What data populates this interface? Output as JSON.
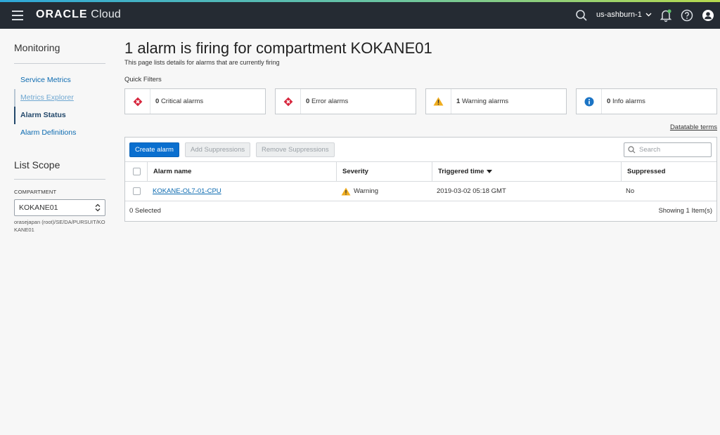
{
  "header": {
    "brand_bold": "ORACLE",
    "brand_rest": " Cloud",
    "region": "us-ashburn-1"
  },
  "icons": {
    "menu": "hamburger-menu-icon",
    "search": "search-icon",
    "notifications": "bell-icon",
    "help": "help-icon",
    "user": "user-icon"
  },
  "sidebar": {
    "title": "Monitoring",
    "items": [
      {
        "label": "Service Metrics",
        "state": "link"
      },
      {
        "label": "Metrics Explorer",
        "state": "visited"
      },
      {
        "label": "Alarm Status",
        "state": "active"
      },
      {
        "label": "Alarm Definitions",
        "state": "link"
      }
    ],
    "scope_title": "List Scope",
    "compartment_label": "COMPARTMENT",
    "compartment_value": "KOKANE01",
    "compartment_path": "orasejapan (root)/SE/DA/PURSUIT/KOKANE01"
  },
  "main": {
    "title": "1 alarm is firing for compartment KOKANE01",
    "subtitle": "This page lists details for alarms that are currently firing",
    "quick_filters_label": "Quick Filters",
    "quick_filters": [
      {
        "count": "0",
        "label": "Critical alarms",
        "icon": "critical-icon",
        "color": "#d7263d"
      },
      {
        "count": "0",
        "label": "Error alarms",
        "icon": "error-icon",
        "color": "#d7263d"
      },
      {
        "count": "1",
        "label": "Warning alarms",
        "icon": "warning-icon",
        "color": "#f0ad1e"
      },
      {
        "count": "0",
        "label": "Info alarms",
        "icon": "info-icon",
        "color": "#1b74c5"
      }
    ],
    "datatable_terms": "Datatable terms",
    "toolbar": {
      "create_label": "Create alarm",
      "add_suppressions_label": "Add Suppressions",
      "remove_suppressions_label": "Remove Suppressions",
      "search_placeholder": "Search"
    },
    "table": {
      "columns": [
        "Alarm name",
        "Severity",
        "Triggered time",
        "Suppressed"
      ],
      "rows": [
        {
          "name": "KOKANE-OL7-01-CPU",
          "severity": "Warning",
          "triggered": "2019-03-02 05:18 GMT",
          "suppressed": "No"
        }
      ],
      "selected_text": "0 Selected",
      "showing_text": "Showing 1 Item(s)"
    }
  },
  "colors": {
    "topbar": "#252b33",
    "primary": "#0a6fcf",
    "link": "#0b6ab0",
    "critical": "#d7263d",
    "warning": "#f0ad1e",
    "info": "#1b74c5"
  }
}
